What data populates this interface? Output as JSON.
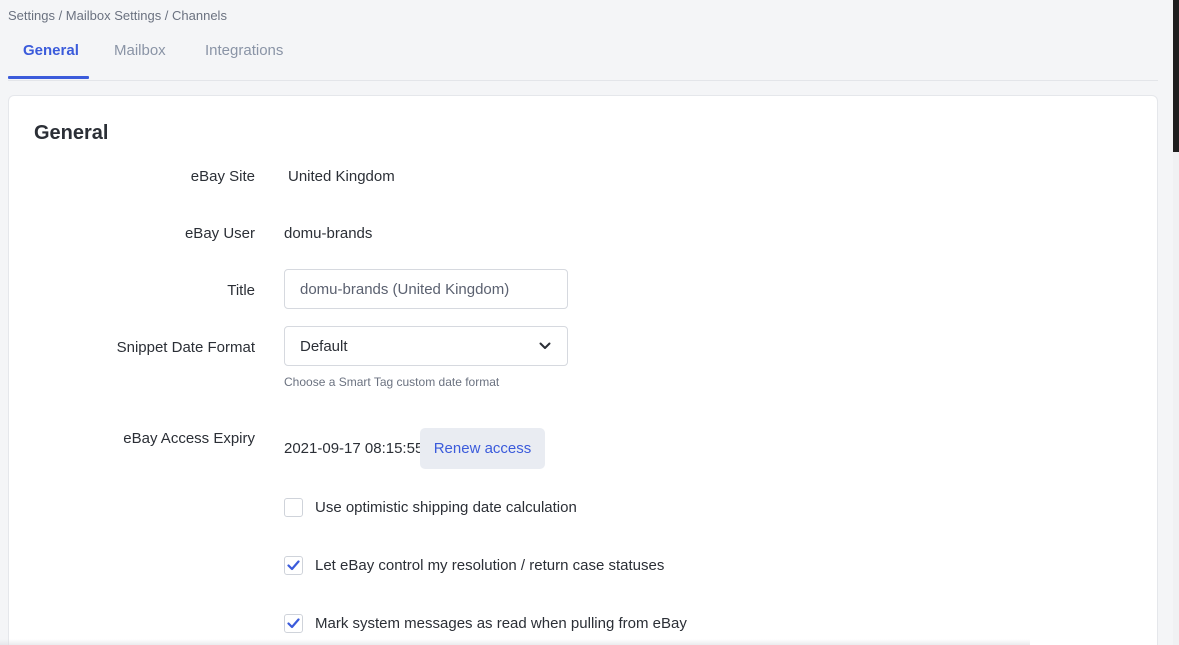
{
  "breadcrumb": "Settings / Mailbox Settings / Channels",
  "tabs": [
    {
      "label": "General",
      "active": true
    },
    {
      "label": "Mailbox",
      "active": false
    },
    {
      "label": "Integrations",
      "active": false
    }
  ],
  "section": {
    "title": "General"
  },
  "fields": {
    "ebay_site": {
      "label": "eBay Site",
      "value": "United Kingdom"
    },
    "ebay_user": {
      "label": "eBay User",
      "value": "domu-brands"
    },
    "title": {
      "label": "Title",
      "value": "domu-brands (United Kingdom)"
    },
    "snippet_date_format": {
      "label": "Snippet Date Format",
      "value": "Default",
      "help": "Choose a Smart Tag custom date format"
    },
    "access_expiry": {
      "label": "eBay Access Expiry",
      "value": "2021-09-17 08:15:55",
      "button": "Renew access"
    }
  },
  "checkboxes": [
    {
      "label": "Use optimistic shipping date calculation",
      "checked": false
    },
    {
      "label": "Let eBay control my resolution / return case statuses",
      "checked": true
    },
    {
      "label": "Mark system messages as read when pulling from eBay",
      "checked": true
    }
  ],
  "colors": {
    "accent": "#3b5bdb",
    "text": "#2b2f36",
    "muted": "#8a94a6"
  },
  "icons": {
    "select_chevron": "chevron-down-icon",
    "checkbox_check": "checkmark-icon"
  }
}
